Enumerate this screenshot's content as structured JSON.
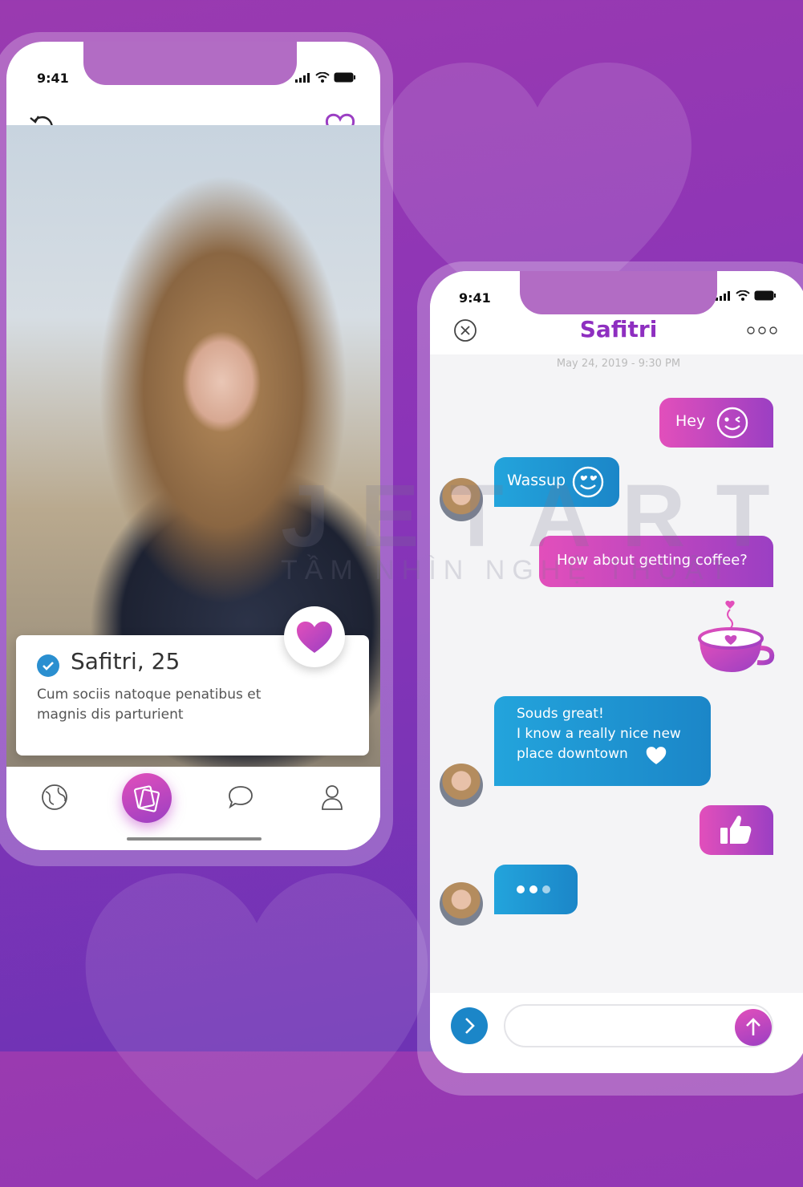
{
  "profile_phone": {
    "status": {
      "time": "9:41"
    },
    "profile": {
      "name_age": "Safitri, 25",
      "description": "Cum sociis natoque penatibus et magnis dis parturient"
    },
    "tabs": [
      {
        "icon": "globe-icon"
      },
      {
        "icon": "cards-icon",
        "active": true
      },
      {
        "icon": "chat-bubble-icon"
      },
      {
        "icon": "user-icon"
      }
    ]
  },
  "chat_phone": {
    "status": {
      "time": "9:41"
    },
    "title": "Safitri",
    "timestamp": "May 24, 2019 - 9:30 PM",
    "messages": [
      {
        "dir": "out",
        "text": "Hey",
        "emoji": "wink-emoji-icon"
      },
      {
        "dir": "in",
        "text": "Wassup",
        "emoji": "heart-eyes-emoji-icon"
      },
      {
        "dir": "out",
        "text": "How about getting coffee?"
      },
      {
        "dir": "out",
        "sticker": "coffee-cup-sticker"
      },
      {
        "dir": "in",
        "lines": [
          "Souds great!",
          "I know a really nice new",
          "place downtown"
        ],
        "emoji": "heart-icon"
      },
      {
        "dir": "out",
        "sticker": "thumbs-up-icon"
      },
      {
        "dir": "in",
        "typing": true
      }
    ],
    "input": {
      "placeholder": "",
      "value": ""
    }
  },
  "watermark": {
    "brand": "JETART",
    "tagline": "TẦM NHÌN NGHỆ THUẬT"
  },
  "colors": {
    "accent_pink": "#e24fbb",
    "accent_purple": "#9b3fc3",
    "accent_blue": "#1b86c8",
    "background": "#8a34b8"
  }
}
